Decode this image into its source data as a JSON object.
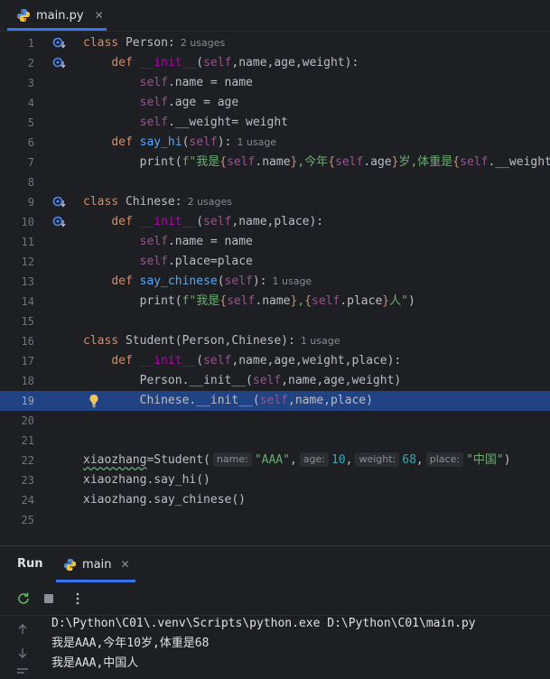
{
  "editor_tab": {
    "filename": "main.py",
    "close": "✕"
  },
  "hints": {
    "usages2": "2 usages",
    "usage1": "1 usage"
  },
  "lines": [
    "1",
    "2",
    "3",
    "4",
    "5",
    "6",
    "7",
    "8",
    "9",
    "10",
    "11",
    "12",
    "13",
    "14",
    "15",
    "16",
    "17",
    "18",
    "19",
    "20",
    "21",
    "22",
    "23",
    "24",
    "25"
  ],
  "code": {
    "l1_kw": "class",
    "l1_name": " Person:",
    "l2_def": "def",
    "l2_init": "__init__",
    "l2_rest": "(",
    "l2_self": "self",
    "l2_args": ",name,age,weight):",
    "l3_self": "self",
    "l3_rest": ".name = name",
    "l4_self": "self",
    "l4_rest": ".age = age",
    "l5_self": "self",
    "l5_rest": ".__weight= weight",
    "l6_def": "def",
    "l6_fn": "say_hi",
    "l6_open": "(",
    "l6_self": "self",
    "l6_close": "):",
    "l7_print": "    print(",
    "l7_s1": "f\"我是",
    "l7_self1": "self",
    "l7_a1": ".name",
    "l7_s2": ",今年",
    "l7_self2": "self",
    "l7_a2": ".age",
    "l7_s3": "岁,体重是",
    "l7_self3": "self",
    "l7_a3": ".__weight",
    "l9_kw": "class",
    "l9_name": " Chinese:",
    "l10_def": "def",
    "l10_init": "__init__",
    "l10_self": "self",
    "l10_args": ",name,place):",
    "l11_self": "self",
    "l11_rest": ".name = name",
    "l12_self": "self",
    "l12_rest": ".place=place",
    "l13_def": "def",
    "l13_fn": "say_chinese",
    "l13_self": "self",
    "l14_s1": "f\"我是",
    "l14_self1": "self",
    "l14_a1": ".name",
    "l14_s2": ",",
    "l14_self2": "self",
    "l14_a2": ".place",
    "l14_s3": "人\"",
    "l16_kw": "class",
    "l16_name": " Student(Person,Chinese):",
    "l17_def": "def",
    "l17_init": "__init__",
    "l17_self": "self",
    "l17_args": ",name,age,weight,place):",
    "l18_a": "Person.",
    "l18_init": "__init__",
    "l18_self": "self",
    "l18_args": ",name,age,weight)",
    "l19_a": "Chinese.",
    "l19_init": "__init__",
    "l19_self": "self",
    "l19_args": ",name,place)",
    "l22_var": "xiaozhang",
    "l22_call": "=Student(",
    "l22_p1": "name:",
    "l22_v1": "\"AAA\"",
    "l22_p2": "age:",
    "l22_v2": "10",
    "l22_p3": "weight:",
    "l22_v3": "68",
    "l22_p4": "place:",
    "l22_v4": "\"中国\"",
    "l23": "xiaozhang.say_hi()",
    "l24": "xiaozhang.say_chinese()"
  },
  "run": {
    "title": "Run",
    "tab": "main",
    "close": "✕"
  },
  "console": [
    "D:\\Python\\C01\\.venv\\Scripts\\python.exe D:\\Python\\C01\\main.py",
    "我是AAA,今年10岁,体重是68",
    "我是AAA,中国人"
  ],
  "colors": {
    "accent": "#3574f0",
    "highlight": "#214283",
    "background": "#1e1f22"
  }
}
